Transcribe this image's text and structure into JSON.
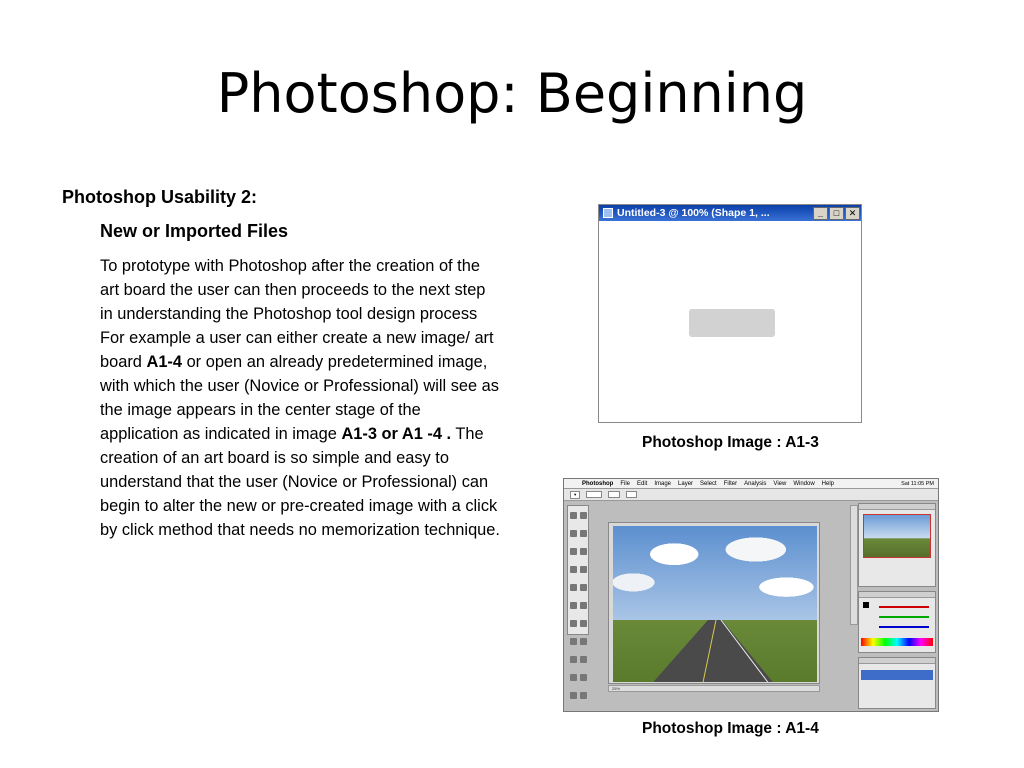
{
  "slide": {
    "title": "Photoshop: Beginning",
    "heading": "Photoshop Usability 2:",
    "subheading": "New or Imported Files",
    "body_parts": [
      {
        "text": "To prototype with Photoshop after the creation of the art board the user can then proceeds to the next step in understanding the Photoshop tool design process For example a user can either create a new image/ art board ",
        "bold": false
      },
      {
        "text": "A1-4",
        "bold": true
      },
      {
        "text": " or open an already predetermined image, with which the user (Novice or Professional) will see as the image appears in the center stage of the application as indicated in image ",
        "bold": false
      },
      {
        "text": "A1-3 or A1 -4 .",
        "bold": true
      },
      {
        "text": " The  creation of an art board is so simple and easy to understand that the user (Novice or Professional) can begin to alter the new or pre-created image with a click by click method that needs no memorization technique.",
        "bold": false
      }
    ]
  },
  "image_a13": {
    "window_title": "Untitled-3 @ 100% (Shape 1, ...",
    "buttons": [
      "_",
      "□",
      "✕"
    ],
    "caption": "Photoshop Image : A1-3"
  },
  "image_a14": {
    "menu": [
      "Photoshop",
      "File",
      "Edit",
      "Image",
      "Layer",
      "Select",
      "Filter",
      "Analysis",
      "View",
      "Window",
      "Help"
    ],
    "clock": "Sat 11:05 PM",
    "status": "25%",
    "caption": "Photoshop Image : A1-4"
  }
}
